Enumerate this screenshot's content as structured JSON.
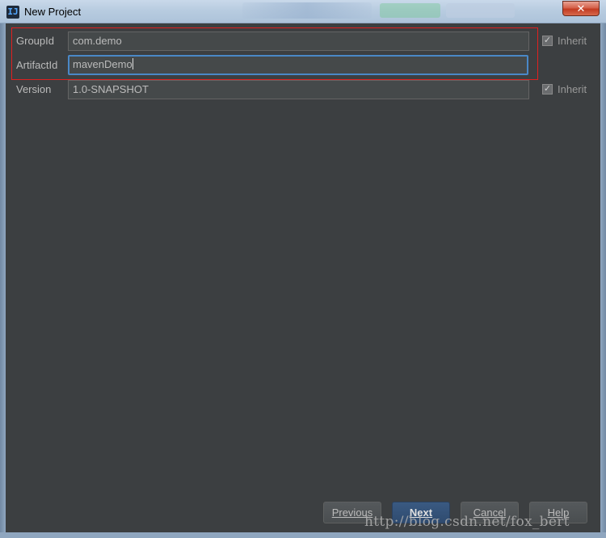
{
  "window": {
    "title": "New Project",
    "app_icon": "IJ",
    "close_glyph": "✕"
  },
  "form": {
    "group_id": {
      "label": "GroupId",
      "value": "com.demo",
      "inherit_label": "Inherit",
      "inherit_checked": true
    },
    "artifact_id": {
      "label": "ArtifactId",
      "value": "mavenDemo",
      "focused": true
    },
    "version": {
      "label": "Version",
      "value": "1.0-SNAPSHOT",
      "inherit_label": "Inherit",
      "inherit_checked": true
    }
  },
  "buttons": {
    "previous": "Previous",
    "next": "Next",
    "cancel": "Cancel",
    "help": "Help"
  },
  "watermark": "http://blog.csdn.net/fox_bert",
  "colors": {
    "dialog_bg": "#3c3f41",
    "field_bg": "#45494a",
    "focus_border": "#4a88c7",
    "highlight_border": "#e02020",
    "primary_button": "#2f4b6f"
  },
  "icons": {
    "app": "intellij-idea-icon",
    "checkbox": "checkmark-icon"
  }
}
